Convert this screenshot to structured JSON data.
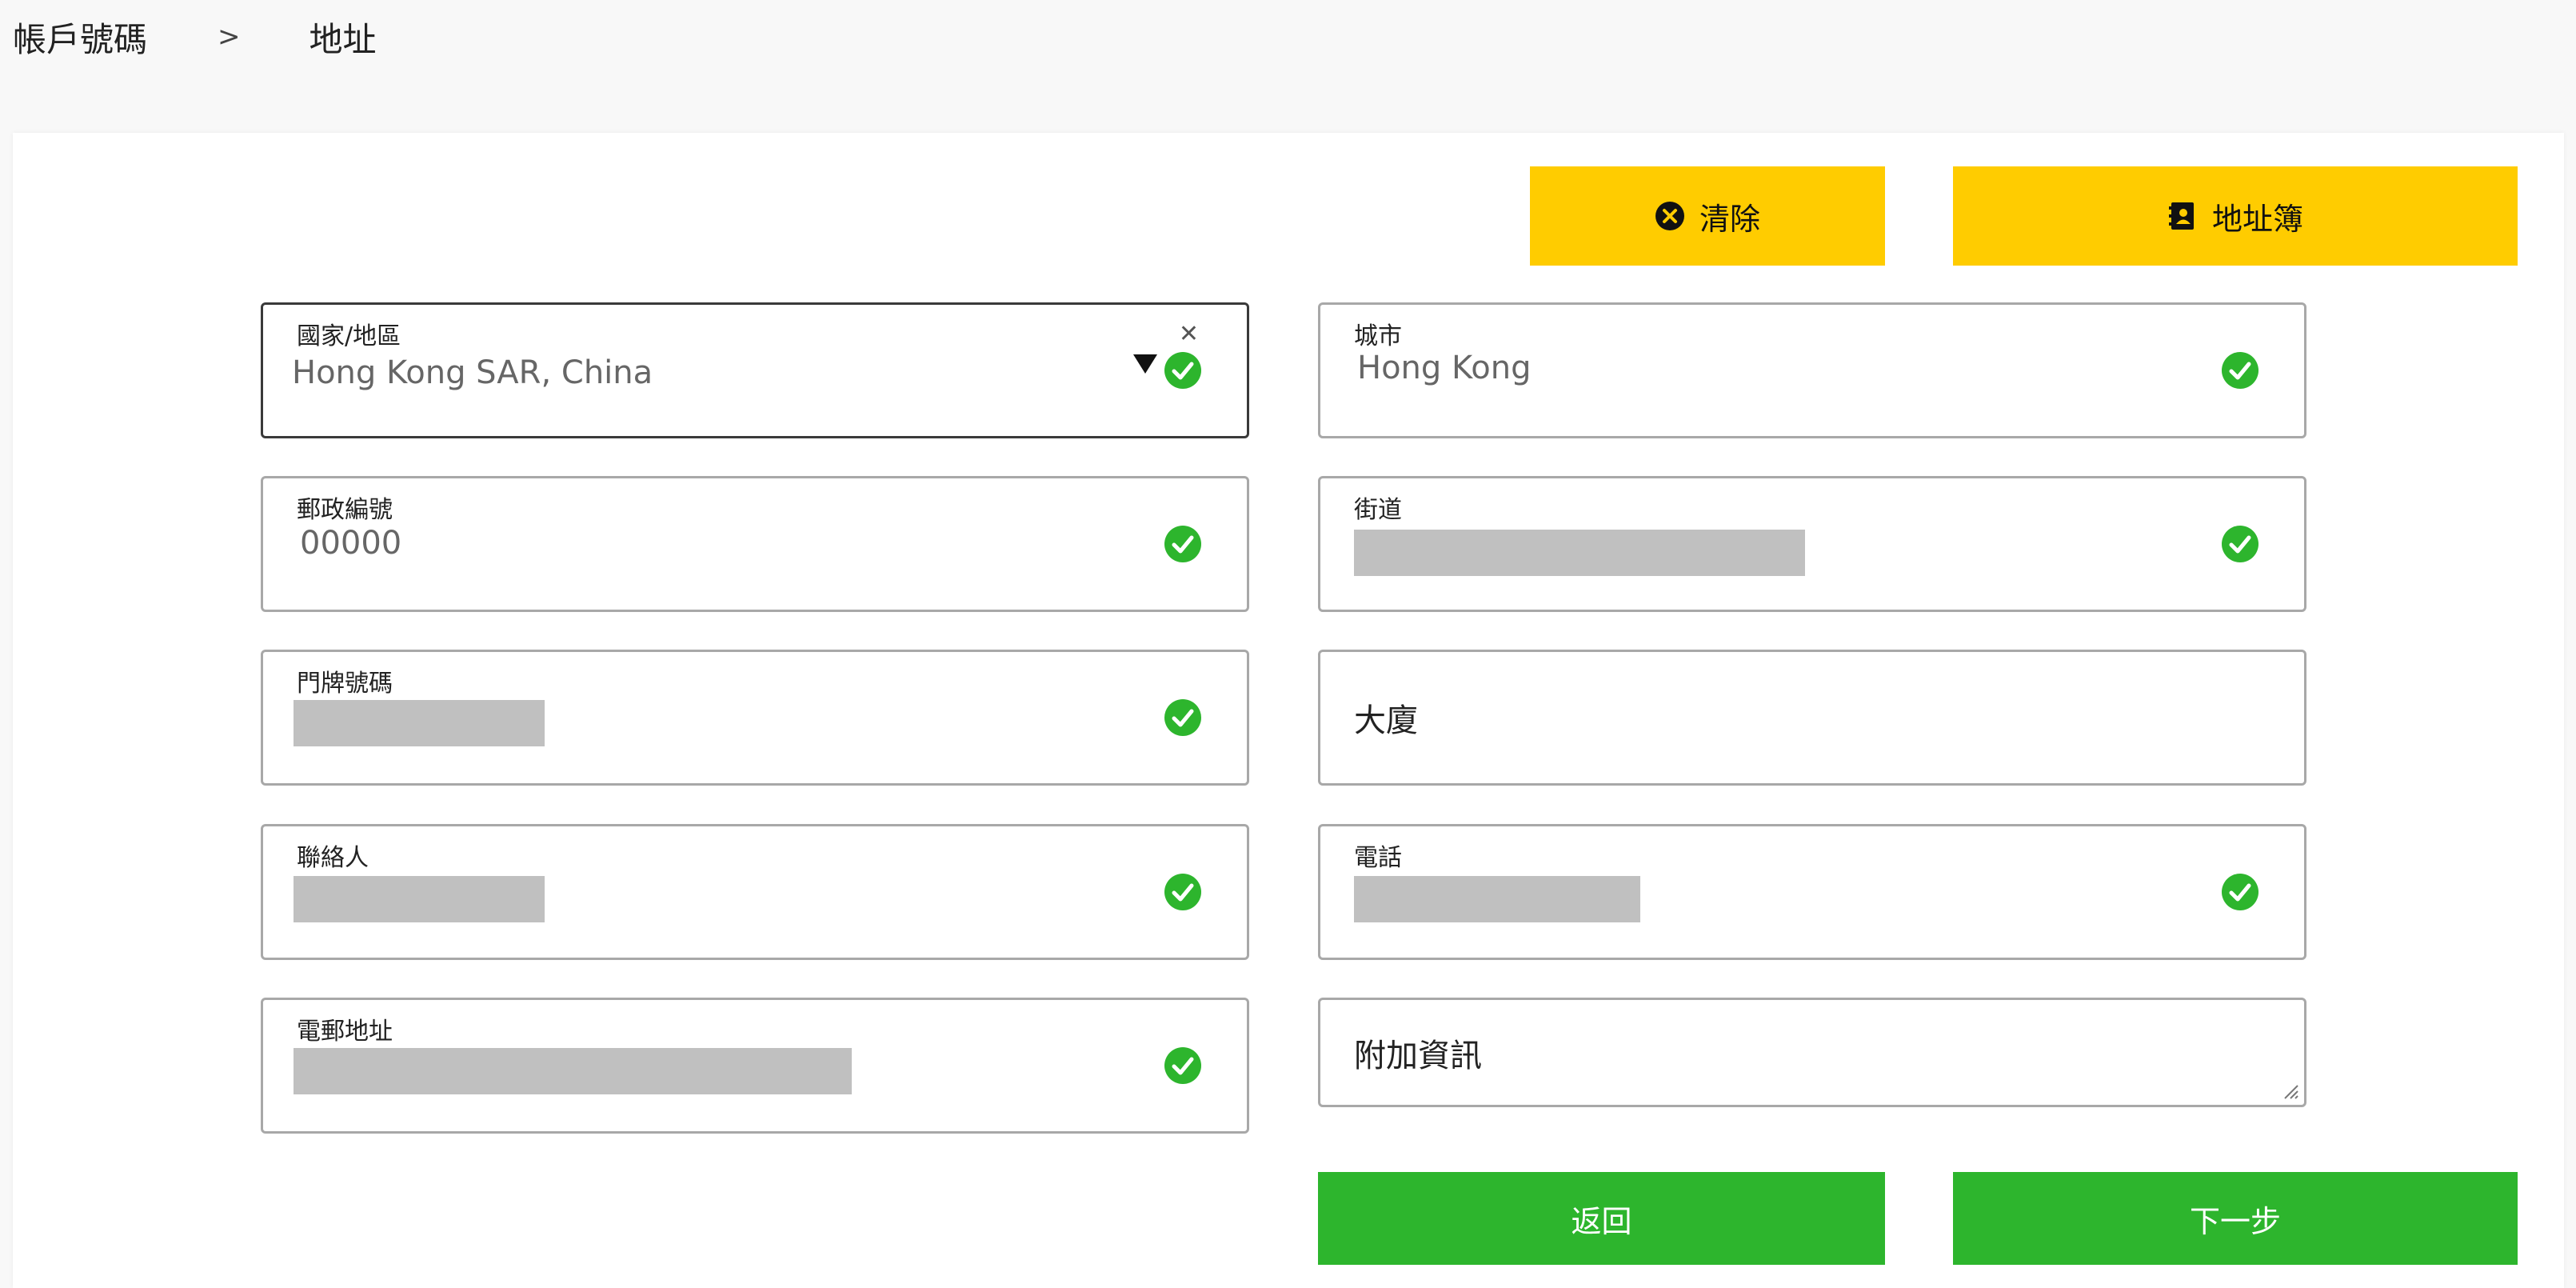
{
  "breadcrumb": {
    "parent": "帳戶號碼",
    "separator": ">",
    "current": "地址"
  },
  "buttons": {
    "clear": "清除",
    "address_book": "地址簿",
    "back": "返回",
    "next": "下一步"
  },
  "fields": {
    "country": {
      "label": "國家/地區",
      "value": "Hong Kong SAR, China"
    },
    "city": {
      "label": "城市",
      "value": "Hong Kong"
    },
    "postal_code": {
      "label": "郵政編號",
      "value": "00000"
    },
    "street": {
      "label": "街道"
    },
    "house_number": {
      "label": "門牌號碼"
    },
    "building": {
      "placeholder": "大廈"
    },
    "contact": {
      "label": "聯絡人"
    },
    "phone": {
      "label": "電話"
    },
    "email": {
      "label": "電郵地址"
    },
    "additional_info": {
      "placeholder": "附加資訊"
    }
  },
  "colors": {
    "accent_yellow": "#ffcc00",
    "action_green": "#2db52d",
    "valid_green": "#2db52d",
    "redaction_gray": "#c0c0c0"
  }
}
